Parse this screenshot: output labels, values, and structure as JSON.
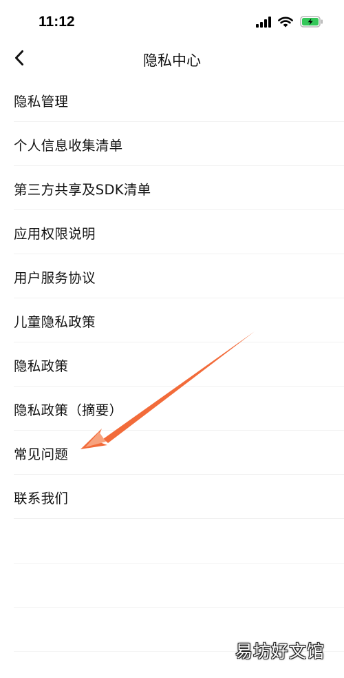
{
  "status_bar": {
    "time": "11:12",
    "icons": [
      "signal-icon",
      "wifi-icon",
      "battery-charging-icon"
    ],
    "battery_color": "#34c759"
  },
  "nav": {
    "back_icon": "chevron-left-icon",
    "title": "隐私中心"
  },
  "menu": {
    "items": [
      {
        "label": "隐私管理"
      },
      {
        "label": "个人信息收集清单"
      },
      {
        "label": "第三方共享及SDK清单"
      },
      {
        "label": "应用权限说明"
      },
      {
        "label": "用户服务协议"
      },
      {
        "label": "儿童隐私政策"
      },
      {
        "label": "隐私政策"
      },
      {
        "label": "隐私政策（摘要）"
      },
      {
        "label": "常见问题"
      },
      {
        "label": "联系我们"
      }
    ]
  },
  "annotation": {
    "type": "arrow",
    "color": "#f26b3a",
    "points_to": "常见问题"
  },
  "watermark": "易坊好文馆"
}
